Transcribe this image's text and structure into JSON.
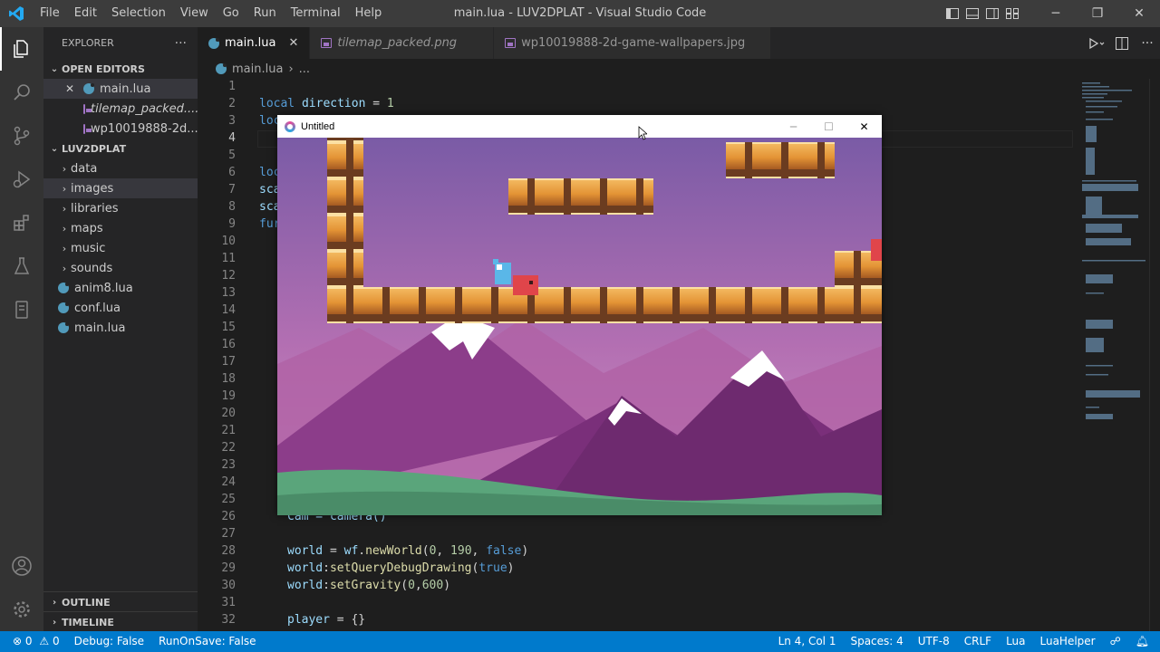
{
  "titlebar": {
    "menu": [
      "File",
      "Edit",
      "Selection",
      "View",
      "Go",
      "Run",
      "Terminal",
      "Help"
    ],
    "window_title": "main.lua - LUV2DPLAT - Visual Studio Code",
    "controls": {
      "minimize": "─",
      "maximize": "❐",
      "close": "✕"
    }
  },
  "activity_bar": {
    "icons": [
      "explorer-icon",
      "search-icon",
      "source-control-icon",
      "run-debug-icon",
      "extensions-icon",
      "testing-icon",
      "remote-icon"
    ],
    "bottom_icons": [
      "account-icon",
      "settings-gear-icon"
    ]
  },
  "sidebar": {
    "title": "EXPLORER",
    "more": "···",
    "open_editors": {
      "label": "OPEN EDITORS",
      "files": [
        {
          "name": "main.lua",
          "close": "✕",
          "icon": "lua-file-icon"
        },
        {
          "name": "tilemap_packed....",
          "icon": "image-file-icon"
        },
        {
          "name": "wp10019888-2d...",
          "icon": "image-file-icon"
        }
      ]
    },
    "project": {
      "label": "LUV2DPLAT",
      "folders": [
        "data",
        "images",
        "libraries",
        "maps",
        "music",
        "sounds"
      ],
      "files": [
        "anim8.lua",
        "conf.lua",
        "main.lua"
      ]
    },
    "outline": "OUTLINE",
    "timeline": "TIMELINE"
  },
  "tabs": [
    {
      "label": "main.lua",
      "close": "✕",
      "icon": "lua-file-icon"
    },
    {
      "label": "tilemap_packed.png",
      "icon": "image-file-icon"
    },
    {
      "label": "wp10019888-2d-game-wallpapers.jpg",
      "icon": "image-file-icon"
    }
  ],
  "breadcrumb": {
    "file": "main.lua",
    "sep": "›",
    "rest": "..."
  },
  "code": {
    "line_numbers": [
      "1",
      "2",
      "3",
      "4",
      "5",
      "6",
      "7",
      "8",
      "9",
      "10",
      "11",
      "12",
      "13",
      "14",
      "15",
      "16",
      "17",
      "18",
      "19",
      "20",
      "21",
      "22",
      "23",
      "24",
      "25",
      "26",
      "27",
      "28",
      "29",
      "30",
      "31",
      "32"
    ],
    "current_line": "4",
    "line2": {
      "kw": "local",
      "var": "direction",
      "op": " = ",
      "num": "1"
    },
    "line3": "loc",
    "line6": "loc",
    "line7": "sca",
    "line8": "sca",
    "line9": "fur",
    "line26": "Cam = camera()",
    "line28": {
      "a": "world",
      "b": " = ",
      "c": "wf",
      "d": ".",
      "e": "newWorld",
      "f": "(",
      "g": "0",
      "h": ", ",
      "i": "190",
      "j": ", ",
      "k": "false",
      "l": ")"
    },
    "line29": {
      "a": "world",
      "b": ":",
      "c": "setQueryDebugDrawing",
      "d": "(",
      "e": "true",
      "f": ")"
    },
    "line30": {
      "a": "world",
      "b": ":",
      "c": "setGravity",
      "d": "(",
      "e": "0",
      "f": ",",
      "g": "600",
      "h": ")"
    },
    "line32": {
      "a": "player",
      "b": " = {}"
    }
  },
  "game_window": {
    "title": "Untitled",
    "controls": {
      "minimize": "─",
      "maximize": "☐",
      "close": "✕"
    }
  },
  "statusbar": {
    "errors": "0",
    "warnings": "0",
    "debug": "Debug: False",
    "run_on_save": "RunOnSave: False",
    "position": "Ln 4, Col 1",
    "spaces": "Spaces: 4",
    "encoding": "UTF-8",
    "eol": "CRLF",
    "language": "Lua",
    "helper": "LuaHelper"
  },
  "colors": {
    "titlebar": "#3c3c3c",
    "activity": "#333333",
    "sidebar": "#252526",
    "editor": "#1e1e1e",
    "statusbar": "#007acc",
    "sky_top": "#7f5fa8",
    "sky_bottom": "#c98bc0",
    "block": "#e8a040"
  }
}
